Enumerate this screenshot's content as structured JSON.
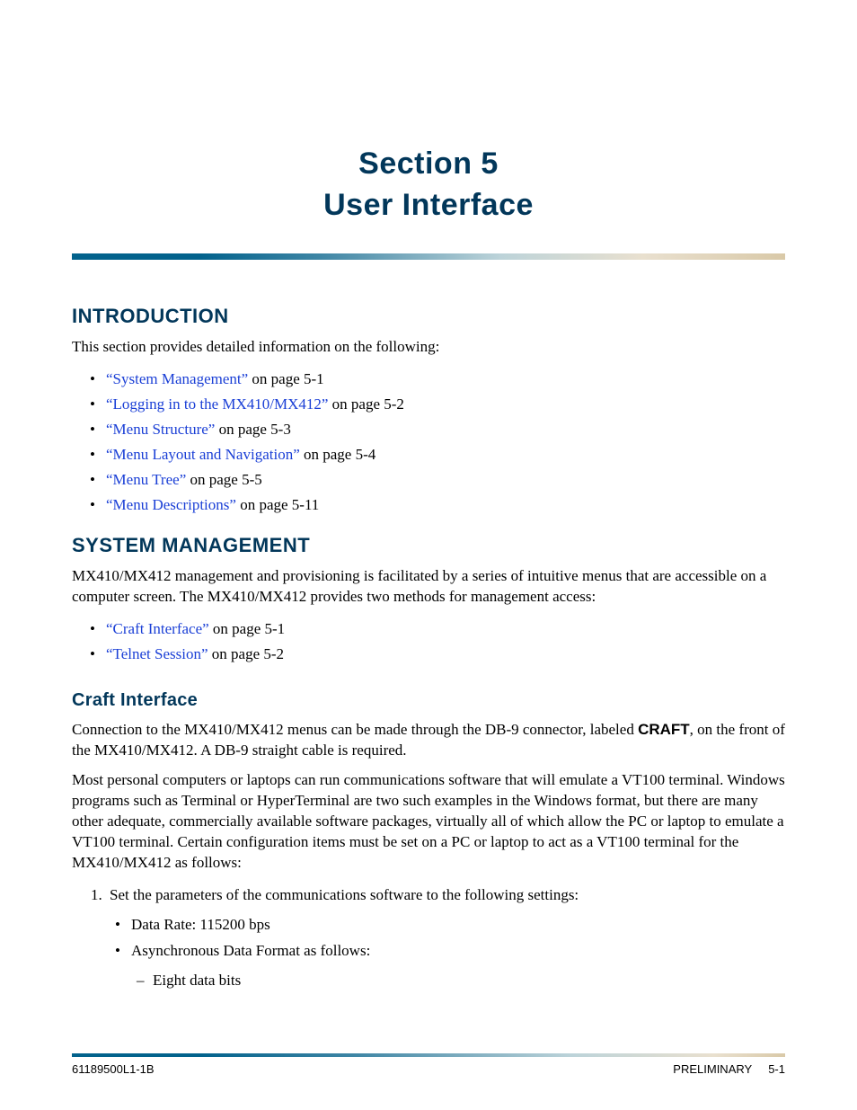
{
  "title_line1": "Section 5",
  "title_line2": "User Interface",
  "intro": {
    "heading": "INTRODUCTION",
    "lead": "This section provides detailed information on the following:",
    "items": [
      {
        "link": "“System Management”",
        "suffix": " on page 5-1"
      },
      {
        "link": "“Logging in to the MX410/MX412”",
        "suffix": " on page 5-2"
      },
      {
        "link": "“Menu Structure”",
        "suffix": " on page 5-3"
      },
      {
        "link": "“Menu Layout and Navigation”",
        "suffix": " on page 5-4"
      },
      {
        "link": "“Menu Tree”",
        "suffix": " on page 5-5"
      },
      {
        "link": "“Menu Descriptions”",
        "suffix": " on page 5-11"
      }
    ]
  },
  "sysmgmt": {
    "heading": "SYSTEM MANAGEMENT",
    "para": "MX410/MX412 management and provisioning is facilitated by a series of intuitive menus that are accessible on a computer screen. The MX410/MX412 provides two methods for management access:",
    "items": [
      {
        "link": "“Craft Interface”",
        "suffix": " on page 5-1"
      },
      {
        "link": "“Telnet Session”",
        "suffix": " on page 5-2"
      }
    ]
  },
  "craft": {
    "heading": "Craft Interface",
    "p1_pre": "Connection to the MX410/MX412 menus can be made through the DB-9 connector, labeled ",
    "p1_bold": "CRAFT",
    "p1_post": ", on the front of the MX410/MX412. A DB-9 straight cable is required.",
    "p2": "Most personal computers or laptops can run communications software that will emulate a VT100 terminal. Windows programs such as Terminal or HyperTerminal are two such examples in the Windows format, but there are many other adequate, commercially available software packages, virtually all of which allow the PC or laptop to emulate a VT100 terminal. Certain configuration items must be set on a PC or laptop to act as a VT100 terminal for the MX410/MX412 as follows:",
    "step1": "Set the parameters of the communications software to the following settings:",
    "bullet1": "Data Rate: 115200 bps",
    "bullet2": "Asynchronous Data Format as follows:",
    "sub1": "Eight data bits"
  },
  "footer": {
    "left": "61189500L1-1B",
    "center": "PRELIMINARY",
    "right": "5-1"
  }
}
